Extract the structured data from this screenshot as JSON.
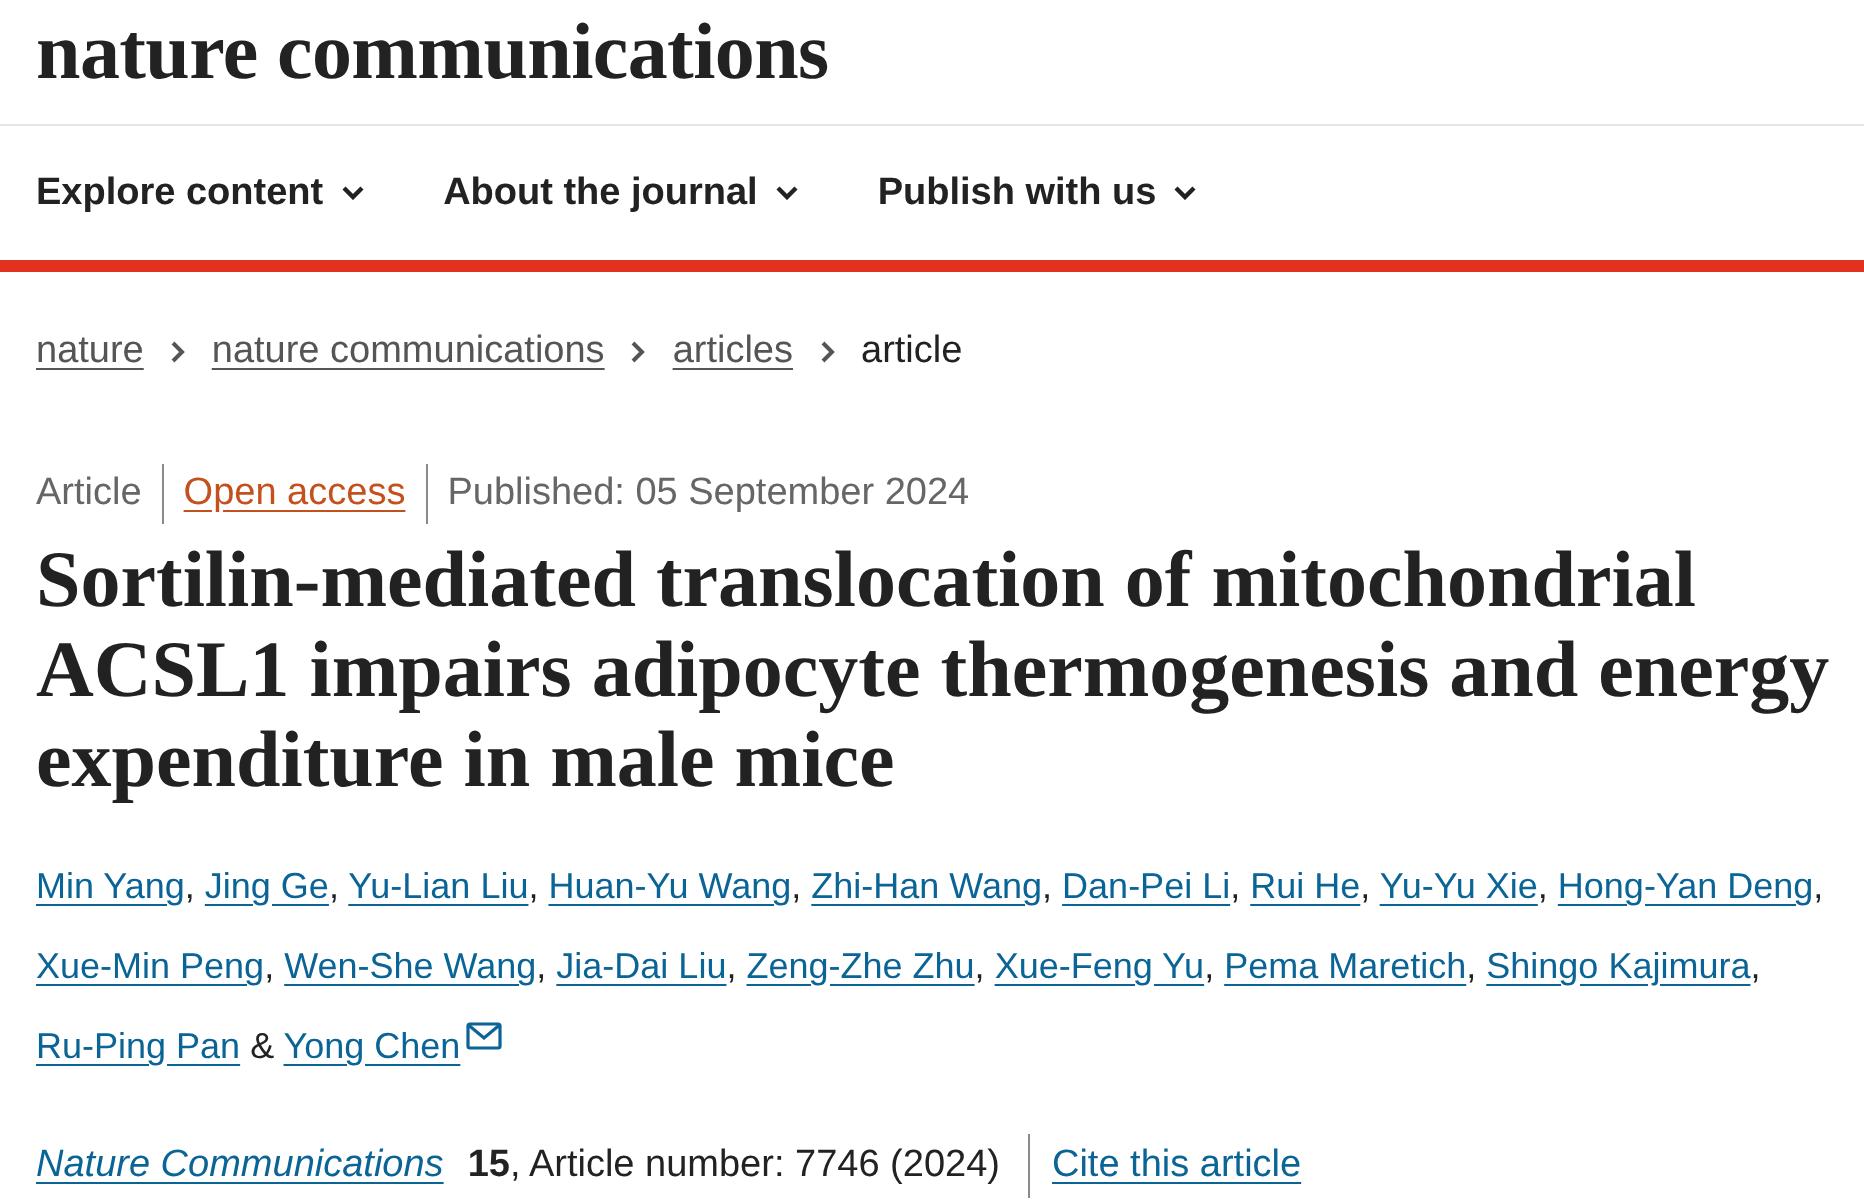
{
  "header": {
    "logo": "nature communications"
  },
  "nav": {
    "items": [
      {
        "label": "Explore content"
      },
      {
        "label": "About the journal"
      },
      {
        "label": "Publish with us"
      }
    ]
  },
  "breadcrumbs": [
    {
      "label": "nature",
      "kind": "link"
    },
    {
      "label": "nature communications",
      "kind": "link"
    },
    {
      "label": "articles",
      "kind": "link"
    },
    {
      "label": "article",
      "kind": "current"
    }
  ],
  "article_info": [
    {
      "text": "Article",
      "kind": "type"
    },
    {
      "text": "Open access",
      "kind": "access"
    },
    {
      "text": "Published: 05 September 2024",
      "kind": "date"
    }
  ],
  "title": "Sortilin-mediated translocation of mitochondrial ACSL1 impairs adipocyte thermogenesis and energy expenditure in male mice",
  "authors": [
    {
      "name": "Min Yang",
      "separator": ", ",
      "email": false
    },
    {
      "name": "Jing Ge",
      "separator": ", ",
      "email": false
    },
    {
      "name": "Yu-Lian Liu",
      "separator": ", ",
      "email": false
    },
    {
      "name": "Huan-Yu Wang",
      "separator": ", ",
      "email": false
    },
    {
      "name": "Zhi-Han Wang",
      "separator": ", ",
      "email": false
    },
    {
      "name": "Dan-Pei Li",
      "separator": ", ",
      "email": false
    },
    {
      "name": "Rui He",
      "separator": ", ",
      "email": false
    },
    {
      "name": "Yu-Yu Xie",
      "separator": ", ",
      "email": false
    },
    {
      "name": "Hong-Yan Deng",
      "separator": ", ",
      "email": false
    },
    {
      "name": "Xue-Min Peng",
      "separator": ", ",
      "email": false
    },
    {
      "name": "Wen-She Wang",
      "separator": ", ",
      "email": false
    },
    {
      "name": "Jia-Dai Liu",
      "separator": ", ",
      "email": false
    },
    {
      "name": "Zeng-Zhe Zhu",
      "separator": ", ",
      "email": false
    },
    {
      "name": "Xue-Feng Yu",
      "separator": ", ",
      "email": false
    },
    {
      "name": "Pema Maretich",
      "separator": ", ",
      "email": false
    },
    {
      "name": "Shingo Kajimura",
      "separator": ", ",
      "email": false
    },
    {
      "name": "Ru-Ping Pan",
      "separator": " & ",
      "email": false
    },
    {
      "name": "Yong Chen",
      "email": true
    }
  ],
  "citation": {
    "journal": "Nature Communications",
    "details": "**15**, Article number: 7746 (2024)",
    "cite_link": "Cite this article"
  }
}
